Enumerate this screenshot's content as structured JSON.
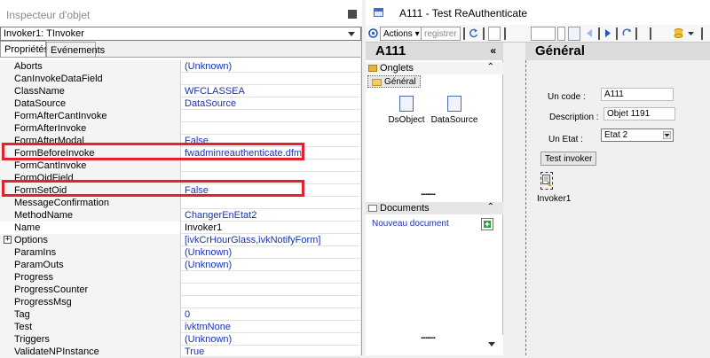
{
  "inspector": {
    "title": "Inspecteur d'objet",
    "selected_object": "Invoker1: TInvoker",
    "tabs": [
      {
        "label": "Propriétés",
        "active": true
      },
      {
        "label": "Evénements",
        "active": false
      }
    ],
    "properties": [
      {
        "name": "Aborts",
        "value": "(Unknown)"
      },
      {
        "name": "CanInvokeDataField",
        "value": ""
      },
      {
        "name": "ClassName",
        "value": "WFCLASSEA"
      },
      {
        "name": "DataSource",
        "value": "DataSource"
      },
      {
        "name": "FormAfterCantInvoke",
        "value": ""
      },
      {
        "name": "FormAfterInvoke",
        "value": ""
      },
      {
        "name": "FormAfterModal",
        "value": "False"
      },
      {
        "name": "FormBeforeInvoke",
        "value": "fwadminreauthenticate.dfm"
      },
      {
        "name": "FormCantInvoke",
        "value": ""
      },
      {
        "name": "FormOidField",
        "value": ""
      },
      {
        "name": "FormSetOid",
        "value": "False"
      },
      {
        "name": "MessageConfirmation",
        "value": ""
      },
      {
        "name": "MethodName",
        "value": "ChangerEnEtat2"
      },
      {
        "name": "Name",
        "value": "Invoker1"
      },
      {
        "name": "Options",
        "value": "[ivkCrHourGlass,ivkNotifyForm]"
      },
      {
        "name": "ParamIns",
        "value": "(Unknown)"
      },
      {
        "name": "ParamOuts",
        "value": "(Unknown)"
      },
      {
        "name": "Progress",
        "value": ""
      },
      {
        "name": "ProgressCounter",
        "value": ""
      },
      {
        "name": "ProgressMsg",
        "value": ""
      },
      {
        "name": "Tag",
        "value": "0"
      },
      {
        "name": "Test",
        "value": "ivktmNone"
      },
      {
        "name": "Triggers",
        "value": "(Unknown)"
      },
      {
        "name": "ValidateNPInstance",
        "value": "True"
      }
    ]
  },
  "designer": {
    "title": "A111 -  Test ReAuthenticate",
    "toolbar": {
      "actions_label": "Actions",
      "register_label": "registrer"
    },
    "left_panel": {
      "header": "A111",
      "collapse_glyph": "«",
      "onglets_label": "Onglets",
      "tree_item": "Général",
      "components": [
        "DsObject",
        "DataSource"
      ],
      "documents_label": "Documents",
      "new_document": "Nouveau document",
      "up_glyph": "⌃",
      "dots": "........."
    },
    "main_panel": {
      "header": "Général",
      "fields": [
        {
          "label": "Un code :",
          "value": "A111"
        },
        {
          "label": "Description :",
          "value": "Objet 1191"
        },
        {
          "label": "Un Etat :",
          "value": "Etat 2"
        }
      ],
      "test_button": "Test invoker",
      "invoker_label": "Invoker1"
    },
    "colors": {
      "highlight": "#e8202a",
      "value_text": "#1a33b3"
    }
  }
}
